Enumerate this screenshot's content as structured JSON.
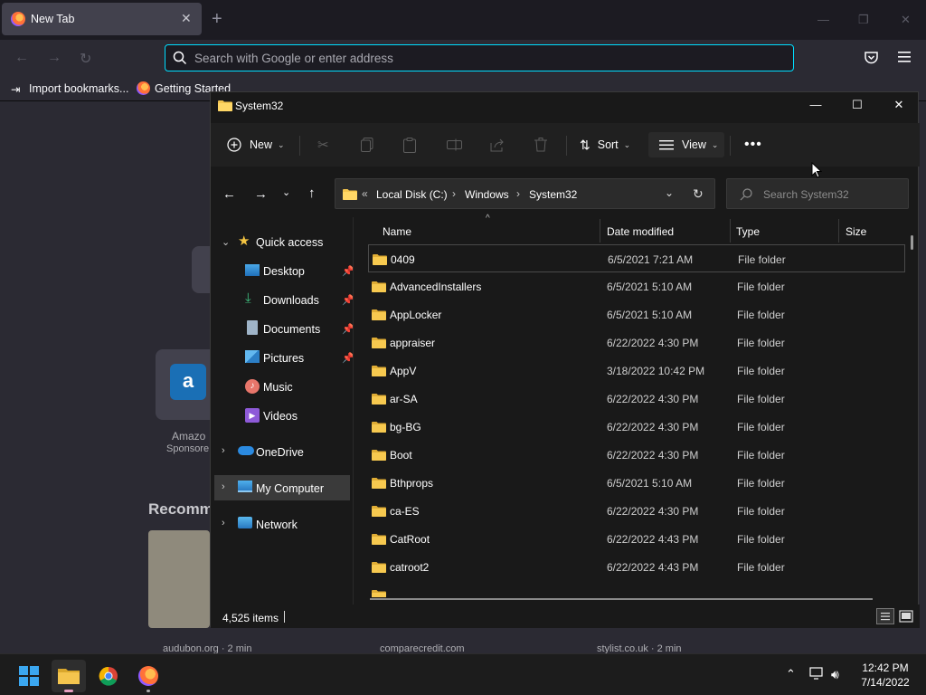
{
  "firefox": {
    "tab_title": "New Tab",
    "url_placeholder": "Search with Google or enter address",
    "bookmarks": [
      "Import bookmarks...",
      "Getting Started"
    ],
    "tile_label": "Amazo",
    "tile_sub": "Sponsore",
    "recommended_heading": "Recomm",
    "card_sources": [
      "audubon.org · 2 min",
      "comparecredit.com",
      "stylist.co.uk · 2 min"
    ]
  },
  "explorer": {
    "title": "System32",
    "toolbar": {
      "new_label": "New",
      "sort_label": "Sort",
      "view_label": "View"
    },
    "breadcrumbs": [
      "Local Disk (C:)",
      "Windows",
      "System32"
    ],
    "search_placeholder": "Search System32",
    "nav": {
      "quick_access": "Quick access",
      "quick_items": [
        "Desktop",
        "Downloads",
        "Documents",
        "Pictures",
        "Music",
        "Videos"
      ],
      "onedrive": "OneDrive",
      "my_computer": "My Computer",
      "network": "Network"
    },
    "columns": {
      "name": "Name",
      "date": "Date modified",
      "type": "Type",
      "size": "Size"
    },
    "files": [
      {
        "name": "0409",
        "date": "6/5/2021 7:21 AM",
        "type": "File folder"
      },
      {
        "name": "AdvancedInstallers",
        "date": "6/5/2021 5:10 AM",
        "type": "File folder"
      },
      {
        "name": "AppLocker",
        "date": "6/5/2021 5:10 AM",
        "type": "File folder"
      },
      {
        "name": "appraiser",
        "date": "6/22/2022 4:30 PM",
        "type": "File folder"
      },
      {
        "name": "AppV",
        "date": "3/18/2022 10:42 PM",
        "type": "File folder"
      },
      {
        "name": "ar-SA",
        "date": "6/22/2022 4:30 PM",
        "type": "File folder"
      },
      {
        "name": "bg-BG",
        "date": "6/22/2022 4:30 PM",
        "type": "File folder"
      },
      {
        "name": "Boot",
        "date": "6/22/2022 4:30 PM",
        "type": "File folder"
      },
      {
        "name": "Bthprops",
        "date": "6/5/2021 5:10 AM",
        "type": "File folder"
      },
      {
        "name": "ca-ES",
        "date": "6/22/2022 4:30 PM",
        "type": "File folder"
      },
      {
        "name": "CatRoot",
        "date": "6/22/2022 4:43 PM",
        "type": "File folder"
      },
      {
        "name": "catroot2",
        "date": "6/22/2022 4:43 PM",
        "type": "File folder"
      }
    ],
    "status_count": "4,525 items"
  },
  "taskbar": {
    "time": "12:42 PM",
    "date": "7/14/2022"
  },
  "colors": {
    "folder": "#f4c54e",
    "accent_cyan": "#00ddff",
    "explorer_bg": "#191919"
  }
}
